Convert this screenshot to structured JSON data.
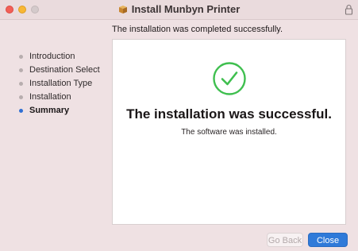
{
  "window": {
    "title": "Install Munbyn Printer"
  },
  "status_text": "The installation was completed successfully.",
  "steps": [
    {
      "label": "Introduction",
      "active": false
    },
    {
      "label": "Destination Select",
      "active": false
    },
    {
      "label": "Installation Type",
      "active": false
    },
    {
      "label": "Installation",
      "active": false
    },
    {
      "label": "Summary",
      "active": true
    }
  ],
  "panel": {
    "headline": "The installation was successful.",
    "subline": "The software was installed."
  },
  "buttons": {
    "back_label": "Go Back",
    "close_label": "Close"
  },
  "icons": {
    "title_icon": "package-icon",
    "lock": "lock-icon",
    "success": "checkmark-circle-icon"
  },
  "colors": {
    "accent": "#2f7ad9",
    "success": "#3fbf4f",
    "active_step_dot": "#2f6fd3"
  }
}
